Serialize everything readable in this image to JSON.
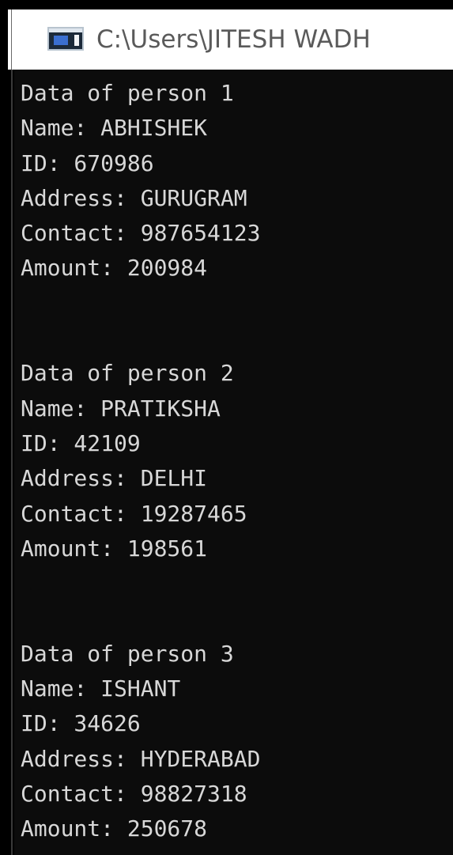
{
  "window": {
    "title": "C:\\Users\\JITESH WADH",
    "icon": "console-window-icon"
  },
  "console": {
    "lines": [
      "Data of person 1",
      "Name: ABHISHEK",
      "ID: 670986",
      "Address: GURUGRAM",
      "Contact: 987654123",
      "Amount: 200984",
      "",
      "",
      "Data of person 2",
      "Name: PRATIKSHA",
      "ID: 42109",
      "Address: DELHI",
      "Contact: 19287465",
      "Amount: 198561",
      "",
      "",
      "Data of person 3",
      "Name: ISHANT",
      "ID: 34626",
      "Address: HYDERABAD",
      "Contact: 98827318",
      "Amount: 250678"
    ]
  },
  "colors": {
    "console_bg": "#0c0c0c",
    "console_text": "#d8d8d8",
    "titlebar_bg": "#ffffff",
    "title_text": "#5a5a5a"
  }
}
